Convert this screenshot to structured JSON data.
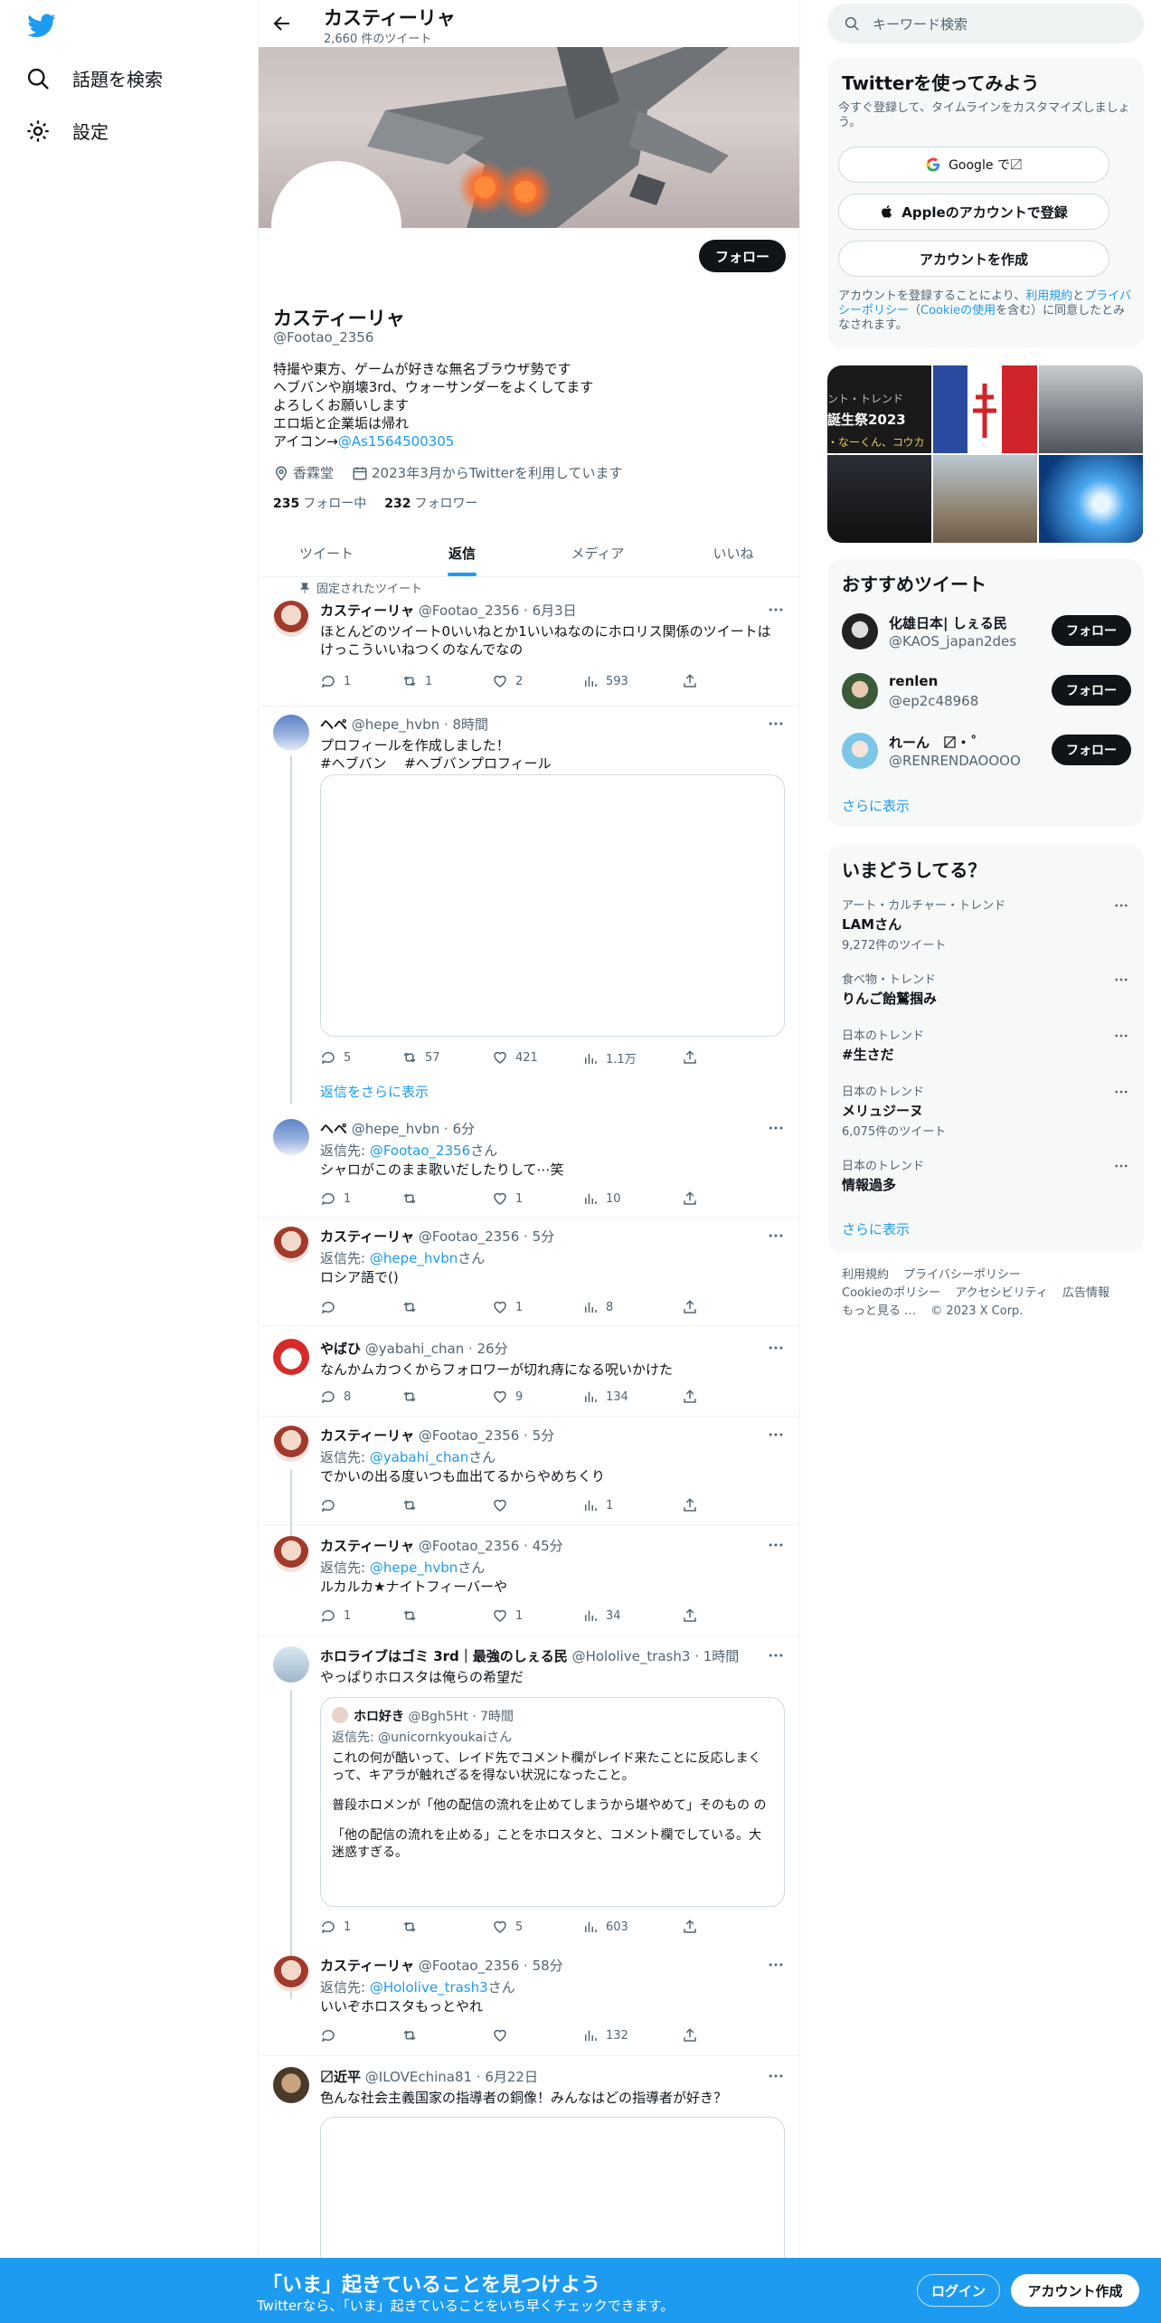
{
  "colors": {
    "accent": "#1d9bf0",
    "text": "#0f1419",
    "muted": "#536471",
    "bottom_bar": "#1d9bf0"
  },
  "nav": {
    "explore": "話題を検索",
    "settings": "設定"
  },
  "header": {
    "title": "カスティーリャ",
    "tweet_count": "2,660 件のツイート"
  },
  "profile": {
    "follow_label": "フォロー",
    "name": "カスティーリャ",
    "handle": "@Footao_2356",
    "bio_lines": [
      "特撮や東方、ゲームが好きな無名ブラウザ勢です",
      "ヘブバンや崩壊3rd、ウォーサンダーをよくしてます",
      "よろしくお願いします",
      "エロ垢と企業垢は帰れ"
    ],
    "bio_icon_prefix": "アイコン→",
    "bio_icon_link": "@As1564500305",
    "location": "香霖堂",
    "joined": "2023年3月からTwitterを利用しています",
    "following_count": "235",
    "following_label": "フォロー中",
    "followers_count": "232",
    "followers_label": "フォロワー"
  },
  "tabs": [
    {
      "label": "ツイート"
    },
    {
      "label": "返信"
    },
    {
      "label": "メディア"
    },
    {
      "label": "いいね"
    }
  ],
  "pinned_label": "固定されたツイート",
  "show_more_replies": "返信をさらに表示",
  "tweets": [
    {
      "name": "カスティーリャ",
      "meta": "@Footao_2356 · 6月3日",
      "text": "ほとんどのツイート0いいねとか1いいねなのにホロリス関係のツイートはけっこういいねつくのなんでなの",
      "reply": "1",
      "retweet": "1",
      "like": "2",
      "views": "593"
    },
    {
      "name": "ヘペ",
      "meta": "@hepe_hvbn · 8時間",
      "text": "プロフィールを作成しました！",
      "tags": "#ヘブバン　 #ヘブバンプロフィール",
      "reply": "5",
      "retweet": "57",
      "like": "421",
      "views": "1.1万"
    },
    {
      "name": "ヘペ",
      "meta": "@hepe_hvbn · 6分",
      "reply_prefix": "返信先: ",
      "reply_to": "@Footao_2356",
      "reply_suffix": "さん",
      "text": "シャロがこのまま歌いだしたりして⋯笑",
      "reply": "1",
      "retweet": "",
      "like": "1",
      "views": "10"
    },
    {
      "name": "カスティーリャ",
      "meta": "@Footao_2356 · 5分",
      "reply_prefix": "返信先: ",
      "reply_to": "@hepe_hvbn",
      "reply_suffix": "さん",
      "text": "ロシア語で()",
      "reply": "",
      "retweet": "",
      "like": "1",
      "views": "8"
    },
    {
      "name": "やばひ",
      "meta": "@yabahi_chan · 26分",
      "text": "なんかムカつくからフォロワーが切れ痔になる呪いかけた",
      "reply": "8",
      "retweet": "",
      "like": "9",
      "views": "134"
    },
    {
      "name": "カスティーリャ",
      "meta": "@Footao_2356 · 5分",
      "reply_prefix": "返信先: ",
      "reply_to": "@yabahi_chan",
      "reply_suffix": "さん",
      "text": "でかいの出る度いつも血出てるからやめちくり",
      "reply": "",
      "retweet": "",
      "like": "",
      "views": "1"
    },
    {
      "name": "カスティーリャ",
      "meta": "@Footao_2356 · 45分",
      "reply_prefix": "返信先: ",
      "reply_to": "@hepe_hvbn",
      "reply_suffix": "さん",
      "text": "ルカルカ★ナイトフィーバーや",
      "reply": "1",
      "retweet": "",
      "like": "1",
      "views": "34"
    },
    {
      "name": "ホロライブはゴミ 3rd｜最強のしぇる民",
      "meta": "@Hololive_trash3 · 1時間",
      "text": "やっぱりホロスタは俺らの希望だ",
      "reply": "1",
      "retweet": "",
      "like": "5",
      "views": "603",
      "quote": {
        "name": "ホロ好き",
        "meta": "@Bgh5Ht · 7時間",
        "reply_line": "返信先: @unicornkyoukaiさん",
        "lines": [
          "これの何が酷いって、レイド先でコメント欄がレイド来たことに反応しまくって、キアラが触れざるを得ない状況になったこと。",
          "普段ホロメンが「他の配信の流れを止めてしまうから堪やめて」そのもの の",
          "「他の配信の流れを止める」ことをホロスタと、コメント欄でしている。大迷惑すぎる。"
        ]
      }
    },
    {
      "name": "カスティーリャ",
      "meta": "@Footao_2356 · 58分",
      "reply_prefix": "返信先: ",
      "reply_to": "@Hololive_trash3",
      "reply_suffix": "さん",
      "text": "いいぞホロスタもっとやれ",
      "reply": "",
      "retweet": "",
      "like": "",
      "views": "132"
    },
    {
      "name": "〼近平",
      "meta": "@ILOVEchina81 · 6月22日",
      "text": "色んな社会主義国家の指導者の銅像！みんなはどの指導者が好き？"
    }
  ],
  "right": {
    "search_placeholder": "キーワード検索",
    "signup": {
      "title": "Twitterを使ってみよう",
      "sub": "今すぐ登録して、タイムラインをカスタマイズしましょう。",
      "google": "Google で〼",
      "apple": "Appleのアカウントで登録",
      "create": "アカウントを作成",
      "legal_pre": "アカウントを登録することにより、",
      "terms": "利用規約",
      "and": "と",
      "privacy": "プライバシーポリシー",
      "cookie_pre": "（",
      "cookie": "Cookieの使用",
      "cookie_post": "を含む）に同意したとみなされます。"
    },
    "grid_texts": [
      "ント・トレンド",
      "誕生祭2023",
      "・なーくん、コウカイ"
    ],
    "rec": {
      "title": "おすすめツイート",
      "users": [
        {
          "name": "化雄日本| しぇる民",
          "handle": "@KAOS_japan2des"
        },
        {
          "name": "renlen",
          "handle": "@ep2c48968"
        },
        {
          "name": "れーん　〼・˚",
          "handle": "@RENRENDAOOOO"
        }
      ],
      "follow": "フォロー",
      "more": "さらに表示"
    },
    "trends": {
      "title": "いまどうしてる？",
      "items": [
        {
          "cat": "アート・カルチャー・トレンド",
          "name": "LAMさん",
          "count": "9,272件のツイート"
        },
        {
          "cat": "食べ物・トレンド",
          "name": "りんご飴鷲掴み",
          "count": ""
        },
        {
          "cat": "日本のトレンド",
          "name": "#生さだ",
          "count": ""
        },
        {
          "cat": "日本のトレンド",
          "name": "メリュジーヌ",
          "count": "6,075件のツイート"
        },
        {
          "cat": "日本のトレンド",
          "name": "情報過多",
          "count": ""
        }
      ],
      "more": "さらに表示"
    },
    "footer": [
      "利用規約",
      "プライバシーポリシー",
      "Cookieのポリシー",
      "アクセシビリティ",
      "広告情報",
      "もっと見る …",
      "© 2023 X Corp."
    ]
  },
  "bottom": {
    "title": "「いま」起きていることを見つけよう",
    "sub": "Twitterなら、「いま」起きていることをいち早くチェックできます。",
    "login": "ログイン",
    "signup": "アカウント作成"
  }
}
